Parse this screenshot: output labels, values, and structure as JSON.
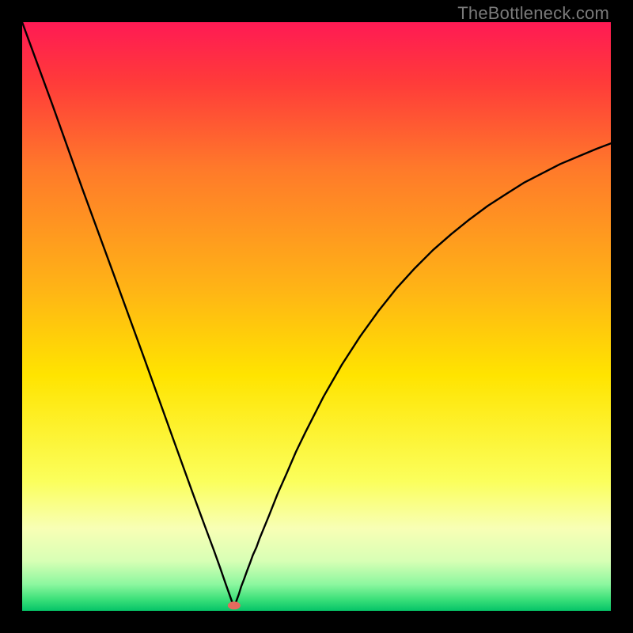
{
  "watermark": "TheBottleneck.com",
  "chart_data": {
    "type": "line",
    "title": "",
    "xlabel": "",
    "ylabel": "",
    "xlim": [
      0,
      100
    ],
    "ylim": [
      0,
      100
    ],
    "grid": false,
    "legend": false,
    "background_gradient": [
      {
        "stop": 0.0,
        "color": "#ff1a54"
      },
      {
        "stop": 0.1,
        "color": "#ff3a3a"
      },
      {
        "stop": 0.25,
        "color": "#ff7a2a"
      },
      {
        "stop": 0.45,
        "color": "#ffb316"
      },
      {
        "stop": 0.6,
        "color": "#ffe400"
      },
      {
        "stop": 0.78,
        "color": "#fbff5c"
      },
      {
        "stop": 0.86,
        "color": "#f8ffb5"
      },
      {
        "stop": 0.915,
        "color": "#d8ffb5"
      },
      {
        "stop": 0.955,
        "color": "#8cf79f"
      },
      {
        "stop": 0.98,
        "color": "#3de07a"
      },
      {
        "stop": 1.0,
        "color": "#05c468"
      }
    ],
    "series": [
      {
        "name": "left-branch",
        "x": [
          0,
          5.2,
          10.3,
          15.5,
          20.7,
          25.8,
          28.9,
          31,
          32.6,
          33.6,
          34.6,
          35.1,
          35.7,
          35.9
        ],
        "y": [
          100,
          85.8,
          71.5,
          57.3,
          43,
          28.8,
          20.2,
          14.5,
          10.2,
          7.4,
          4.5,
          3.1,
          1.4,
          0.9
        ]
      },
      {
        "name": "right-branch",
        "x": [
          36.1,
          36.8,
          37.2,
          37.7,
          38.2,
          38.7,
          39.2,
          39.8,
          40.3,
          41.9,
          43.4,
          45,
          46.5,
          48.1,
          51.2,
          54.3,
          57.4,
          60.5,
          63.6,
          66.7,
          69.8,
          72.9,
          76,
          79.1,
          82.2,
          85.2,
          88.3,
          91.4,
          94.5,
          97.6,
          100
        ],
        "y": [
          0.9,
          2.8,
          4.1,
          5.4,
          6.8,
          8.1,
          9.5,
          10.8,
          12.2,
          16.1,
          19.9,
          23.5,
          27,
          30.3,
          36.4,
          41.8,
          46.6,
          50.9,
          54.8,
          58.2,
          61.3,
          64,
          66.5,
          68.8,
          70.8,
          72.7,
          74.3,
          75.9,
          77.2,
          78.5,
          79.4
        ]
      }
    ],
    "marker": {
      "x": 36,
      "y": 0.9,
      "color": "#e46a5e",
      "rx": 8,
      "ry": 5
    }
  }
}
